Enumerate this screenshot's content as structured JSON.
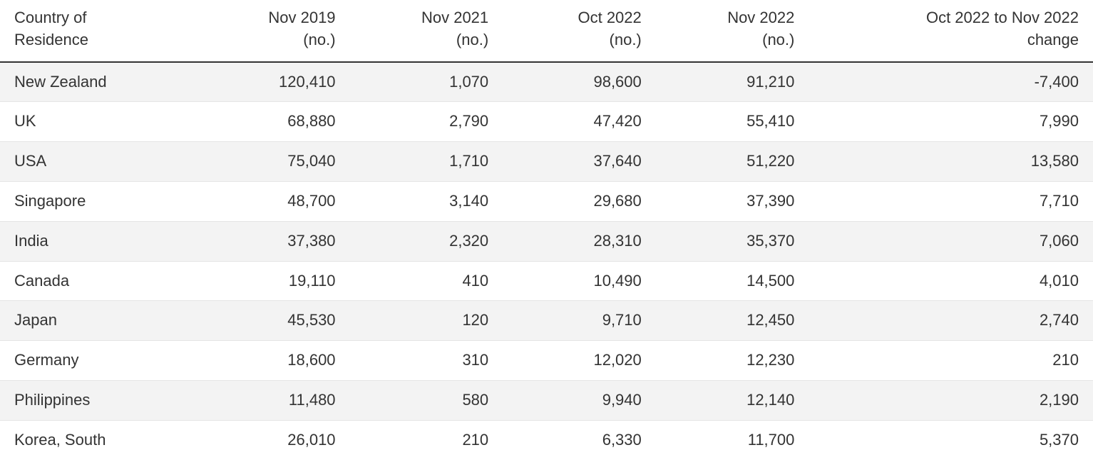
{
  "chart_data": {
    "type": "table",
    "columns": [
      {
        "key": "country",
        "header": "Country of Residence"
      },
      {
        "key": "nov2019",
        "header": "Nov 2019 (no.)"
      },
      {
        "key": "nov2021",
        "header": "Nov 2021 (no.)"
      },
      {
        "key": "oct2022",
        "header": "Oct 2022 (no.)"
      },
      {
        "key": "nov2022",
        "header": "Nov 2022 (no.)"
      },
      {
        "key": "change",
        "header": "Oct 2022 to Nov 2022 change"
      }
    ],
    "rows": [
      {
        "country": "New Zealand",
        "nov2019": 120410,
        "nov2021": 1070,
        "oct2022": 98600,
        "nov2022": 91210,
        "change": -7400
      },
      {
        "country": "UK",
        "nov2019": 68880,
        "nov2021": 2790,
        "oct2022": 47420,
        "nov2022": 55410,
        "change": 7990
      },
      {
        "country": "USA",
        "nov2019": 75040,
        "nov2021": 1710,
        "oct2022": 37640,
        "nov2022": 51220,
        "change": 13580
      },
      {
        "country": "Singapore",
        "nov2019": 48700,
        "nov2021": 3140,
        "oct2022": 29680,
        "nov2022": 37390,
        "change": 7710
      },
      {
        "country": "India",
        "nov2019": 37380,
        "nov2021": 2320,
        "oct2022": 28310,
        "nov2022": 35370,
        "change": 7060
      },
      {
        "country": "Canada",
        "nov2019": 19110,
        "nov2021": 410,
        "oct2022": 10490,
        "nov2022": 14500,
        "change": 4010
      },
      {
        "country": "Japan",
        "nov2019": 45530,
        "nov2021": 120,
        "oct2022": 9710,
        "nov2022": 12450,
        "change": 2740
      },
      {
        "country": "Germany",
        "nov2019": 18600,
        "nov2021": 310,
        "oct2022": 12020,
        "nov2022": 12230,
        "change": 210
      },
      {
        "country": "Philippines",
        "nov2019": 11480,
        "nov2021": 580,
        "oct2022": 9940,
        "nov2022": 12140,
        "change": 2190
      },
      {
        "country": "Korea, South",
        "nov2019": 26010,
        "nov2021": 210,
        "oct2022": 6330,
        "nov2022": 11700,
        "change": 5370
      }
    ]
  },
  "headers": {
    "country_l1": "Country of",
    "country_l2": "Residence",
    "nov2019_l1": "Nov 2019",
    "nov2019_l2": "(no.)",
    "nov2021_l1": "Nov 2021",
    "nov2021_l2": "(no.)",
    "oct2022_l1": "Oct 2022",
    "oct2022_l2": "(no.)",
    "nov2022_l1": "Nov 2022",
    "nov2022_l2": "(no.)",
    "change_l1": "Oct 2022 to Nov 2022",
    "change_l2": "change"
  }
}
